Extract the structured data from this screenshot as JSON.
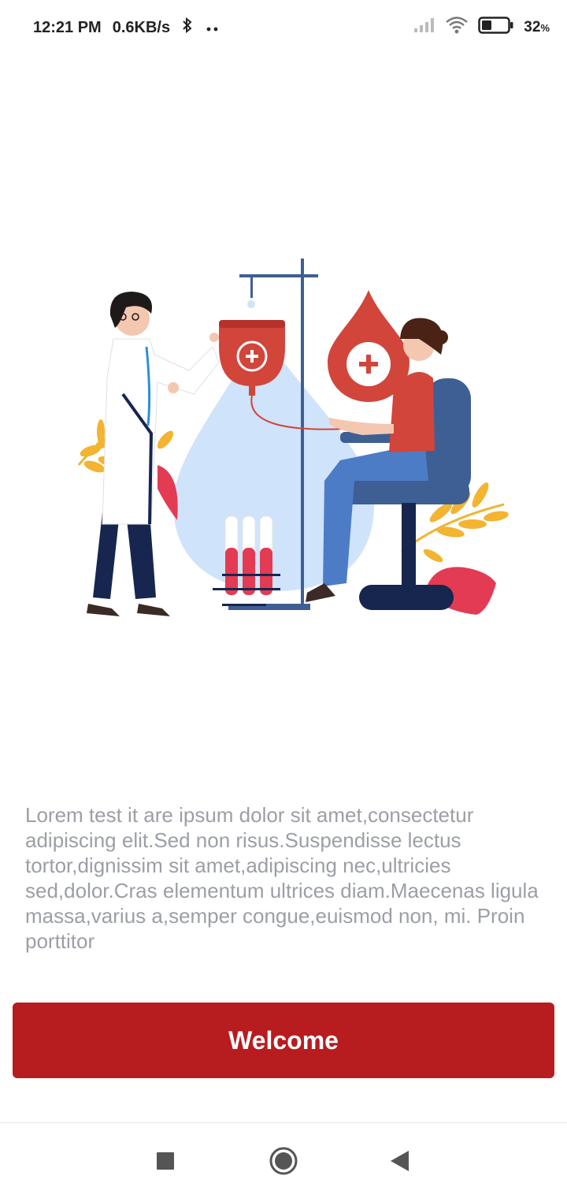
{
  "status_bar": {
    "time": "12:21 PM",
    "network_speed": "0.6KB/s",
    "battery_percent": "32",
    "battery_unit": "%",
    "battery_level": 0.32,
    "icons": [
      "bluetooth-icon",
      "more-dots-icon",
      "signal-icon",
      "wifi-icon",
      "battery-icon"
    ]
  },
  "illustration": {
    "name": "blood-donation-illustration",
    "colors": {
      "blood_red": "#d2453b",
      "drop_blue": "#cfe3fb",
      "chair_blue": "#3e5f94",
      "leaf_yellow": "#f2b431",
      "leaf_pink": "#e33b53",
      "navy": "#17264f"
    }
  },
  "description": "Lorem test it are ipsum dolor sit amet,consectetur adipiscing elit.Sed non risus.Suspendisse lectus tortor,dignissim sit amet,adipiscing nec,ultricies sed,dolor.Cras elementum ultrices diam.Maecenas ligula massa,varius a,semper congue,euismod non, mi. Proin porttitor",
  "welcome_button": {
    "label": "Welcome",
    "color": "#b71c1f"
  },
  "nav_bar": {
    "icons": [
      "recents-square-icon",
      "home-circle-icon",
      "back-triangle-icon"
    ]
  }
}
